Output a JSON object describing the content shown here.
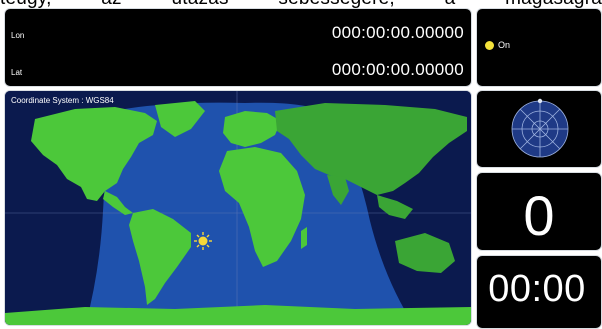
{
  "header_text": "teugy, az utazas sebessegere, a magasagra",
  "coordinates": {
    "lon_label": "Lon",
    "lon_value": "000:00:00.00000",
    "lat_label": "Lat",
    "lat_value": "000:00:00.00000"
  },
  "status": {
    "label": "On",
    "dot_color": "#f3e13a"
  },
  "map": {
    "title": "Coordinate System : WGS84",
    "ocean_color": "#0c1c52",
    "daylight_color": "#1d4fa8",
    "land_color": "#4cc83a",
    "land_night_color": "#3aa535",
    "sun_icon": "sun-icon"
  },
  "sky_plot": {
    "icon": "skyplot-icon"
  },
  "satellite_count": "0",
  "time_display": "00:00"
}
